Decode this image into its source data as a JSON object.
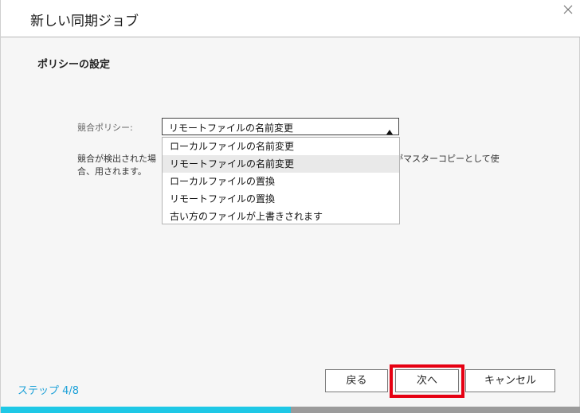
{
  "window": {
    "title": "新しい同期ジョブ",
    "close_icon": "close-icon"
  },
  "section": {
    "title": "ポリシーの設定"
  },
  "policy": {
    "label": "競合ポリシー:",
    "selected": "リモートファイルの名前変更",
    "arrow_icon": "triangle-up-icon",
    "options": [
      "ローカルファイルの名前変更",
      "リモートファイルの名前変更",
      "ローカルファイルの置換",
      "リモートファイルの置換",
      "古い方のファイルが上書きされます"
    ],
    "highlighted_index": 1
  },
  "description": {
    "left_text": "競合が検出された場合、用されます。",
    "right_text": "がマスターコピーとして使"
  },
  "footer": {
    "step_label": "ステップ 4/8",
    "back_label": "戻る",
    "next_label": "次へ",
    "cancel_label": "キャンセル",
    "highlight_color": "#e60012",
    "progress": 0.5
  },
  "colors": {
    "accent": "#1da1d8",
    "progress_fill": "#1ec8e6",
    "progress_track": "#9b9b9b"
  }
}
